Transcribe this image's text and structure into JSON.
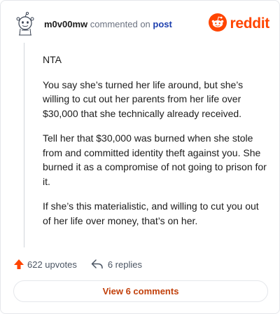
{
  "comment": {
    "username": "m0v00mw",
    "action_text": "commented on",
    "post_link": "post",
    "paragraphs": [
      "NTA",
      "You say she’s turned her life around, but she’s willing to cut out her parents from her life over $30,000 that she technically already received.",
      "Tell her that $30,000 was burned when she stole from and committed identity theft against you. She burned it as a compromise of not going to prison for it.",
      "If she’s this materialistic, and willing to cut you out of her life over money, that’s on her."
    ]
  },
  "brand": {
    "name": "reddit",
    "color": "#ff4500"
  },
  "stats": {
    "upvotes": "622 upvotes",
    "replies": "6 replies"
  },
  "view_button": "View 6 comments",
  "icons": {
    "avatar": "snoo-avatar-icon",
    "logo": "reddit-logo-icon",
    "upvote": "upvote-arrow-icon",
    "reply": "reply-arrow-icon"
  }
}
